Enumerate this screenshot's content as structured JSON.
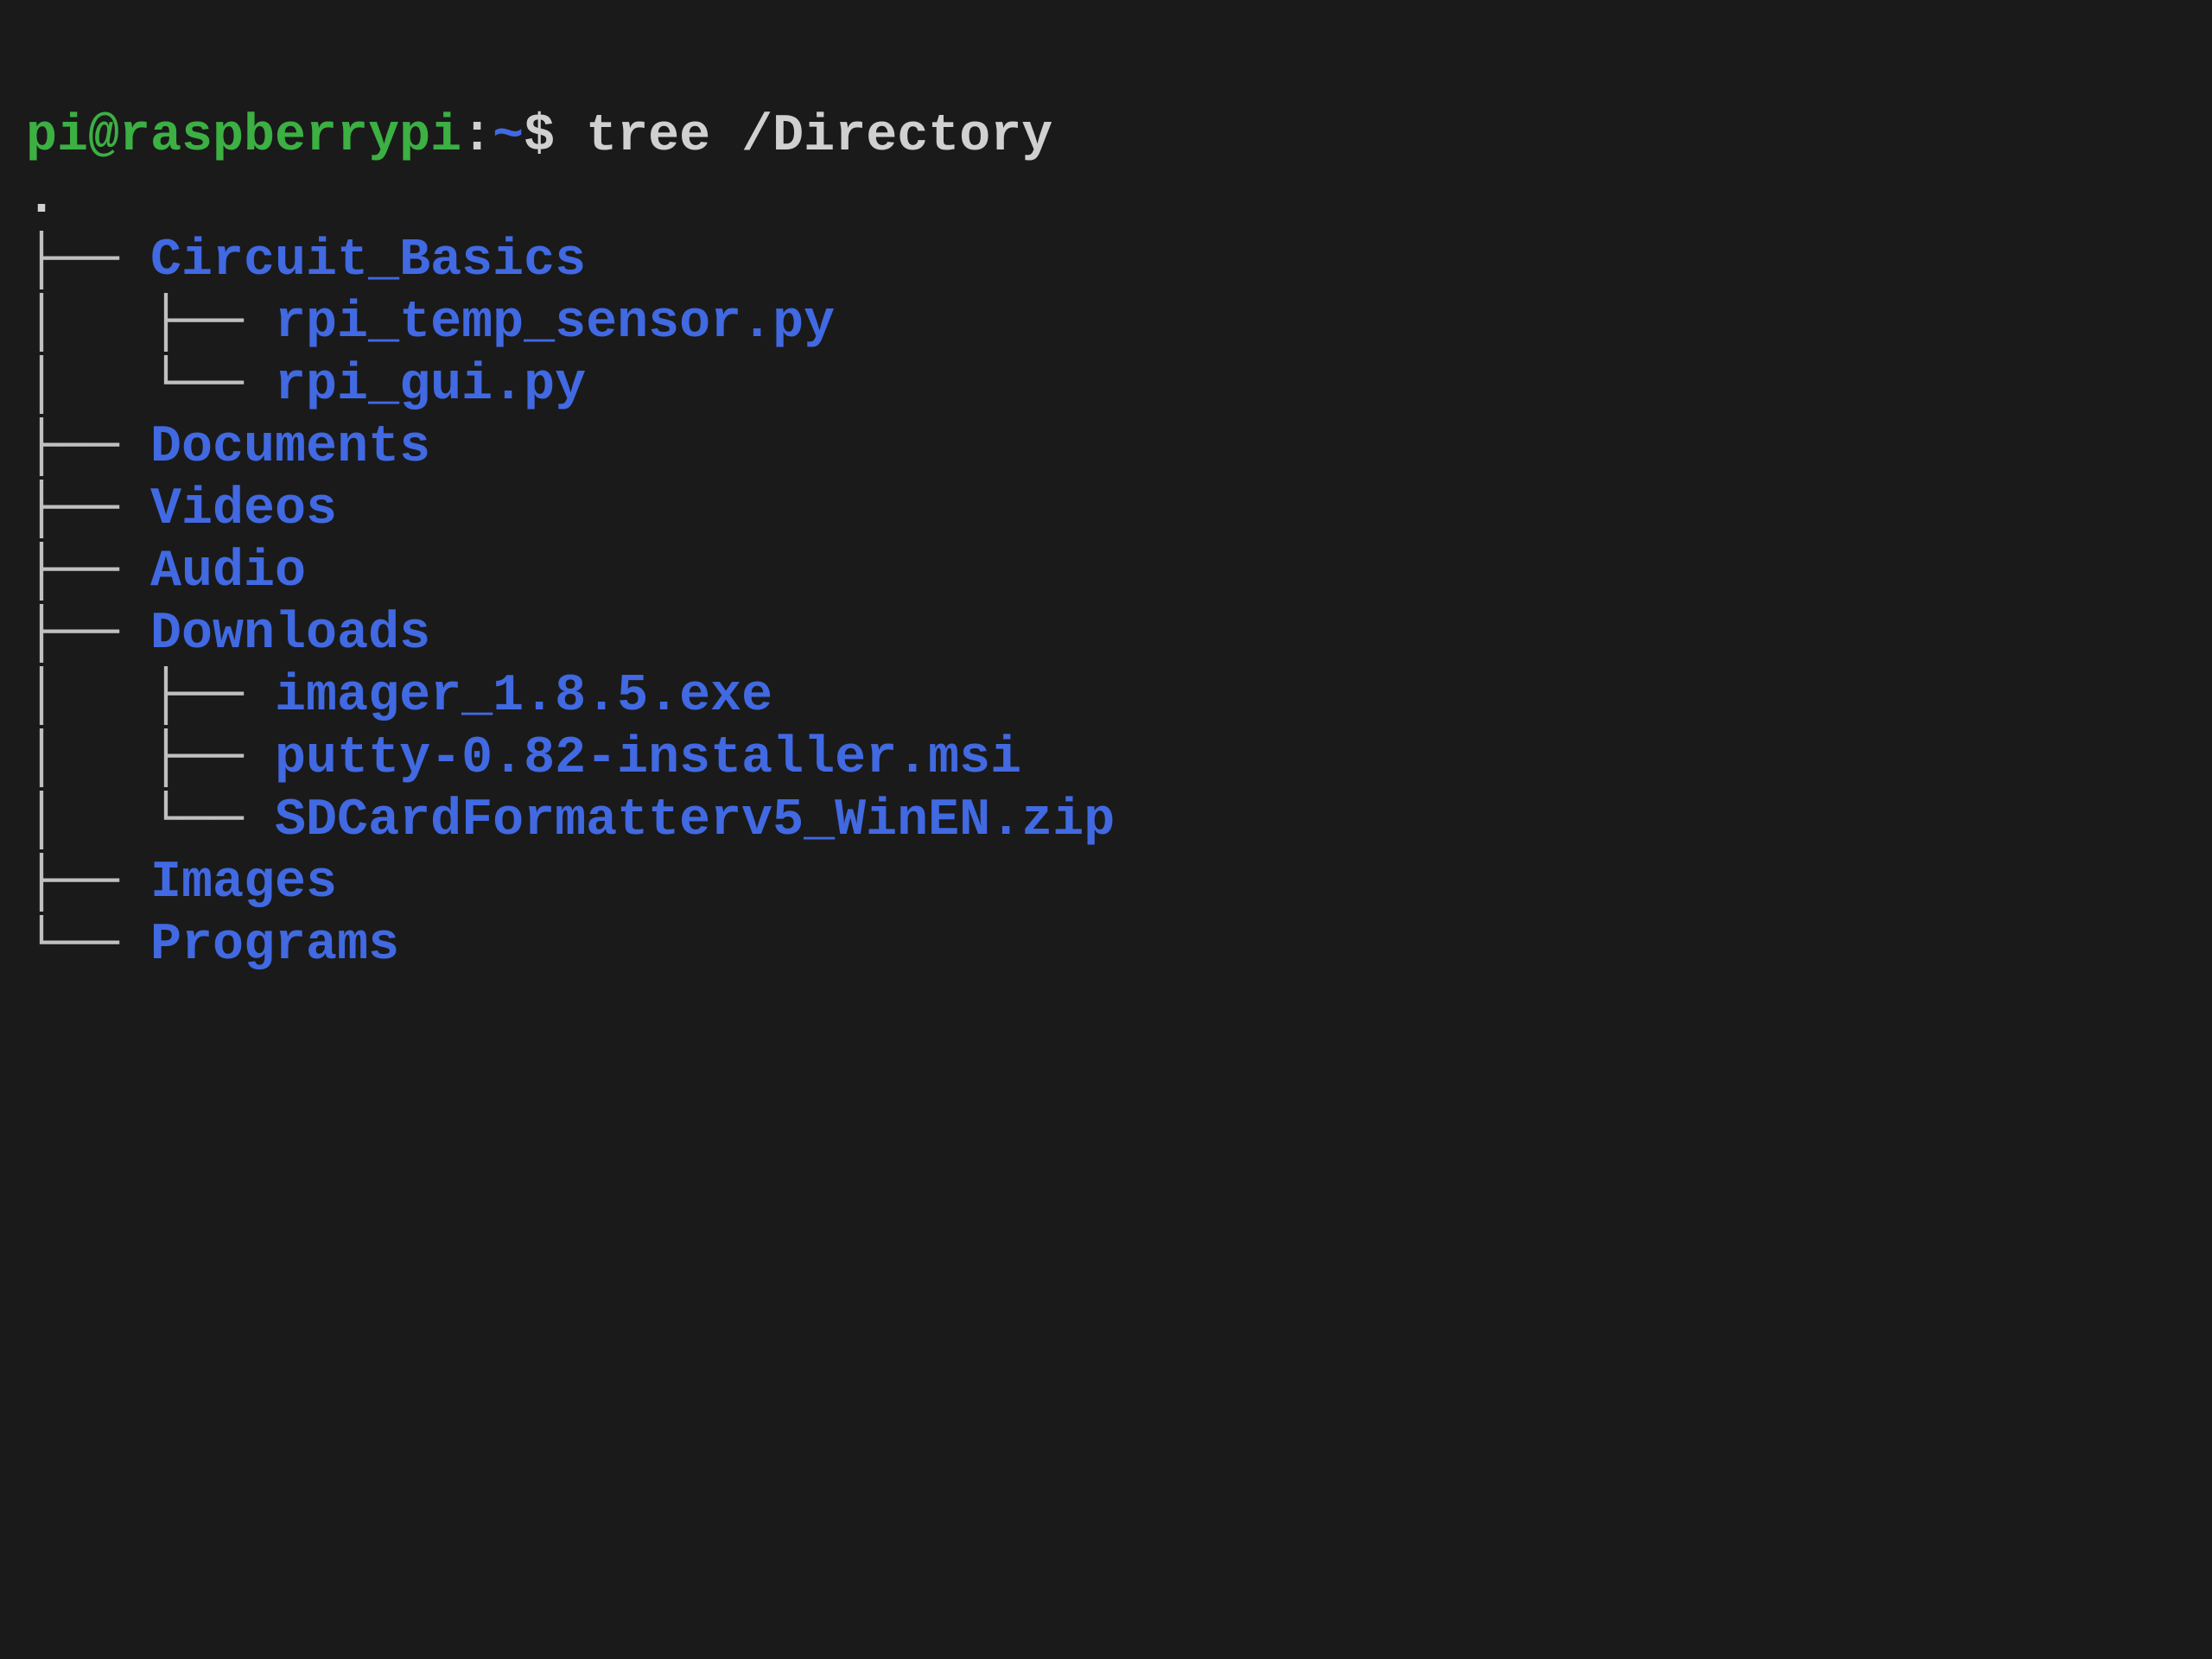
{
  "prompt": {
    "user_host": "pi@raspberrypi",
    "separator": ":",
    "path": "~",
    "dollar": "$ "
  },
  "command": "tree /Directory",
  "tree": {
    "root_dot": ".",
    "lines": [
      {
        "prefix": "├── ",
        "name": "Circuit_Basics"
      },
      {
        "prefix": "│   ├── ",
        "name": "rpi_temp_sensor.py"
      },
      {
        "prefix": "│   └── ",
        "name": "rpi_gui.py"
      },
      {
        "prefix": "├── ",
        "name": "Documents"
      },
      {
        "prefix": "├── ",
        "name": "Videos"
      },
      {
        "prefix": "├── ",
        "name": "Audio"
      },
      {
        "prefix": "├── ",
        "name": "Downloads"
      },
      {
        "prefix": "│   ├── ",
        "name": "imager_1.8.5.exe"
      },
      {
        "prefix": "│   ├── ",
        "name": "putty-0.82-installer.msi"
      },
      {
        "prefix": "│   └── ",
        "name": "SDCardFormatterv5_WinEN.zip"
      },
      {
        "prefix": "├── ",
        "name": "Images"
      },
      {
        "prefix": "└── ",
        "name": "Programs"
      }
    ]
  }
}
